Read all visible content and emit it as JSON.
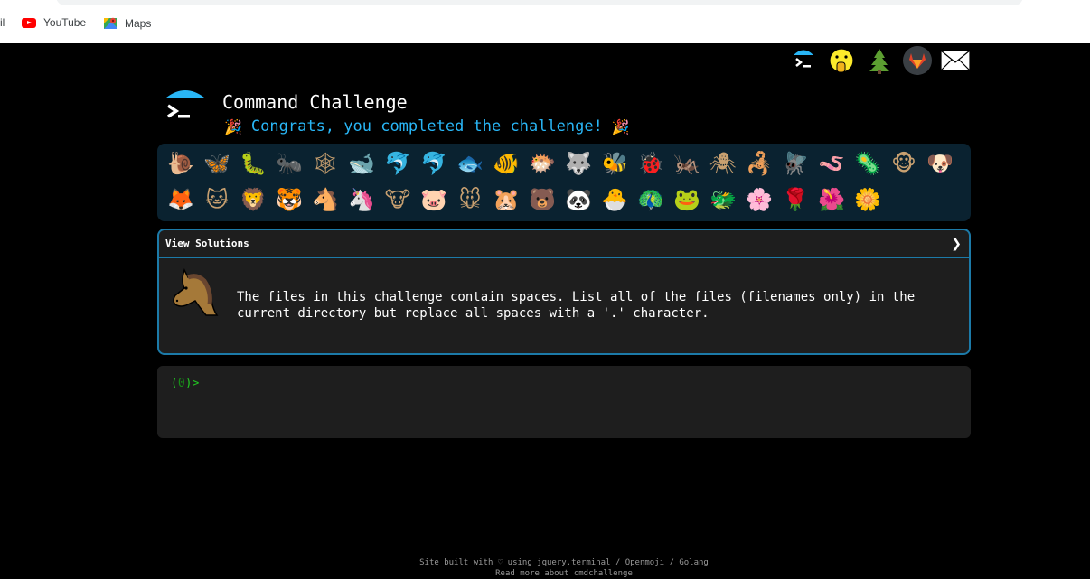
{
  "browser": {
    "bookmarks": [
      {
        "label": "il"
      },
      {
        "label": "YouTube"
      },
      {
        "label": "Maps"
      }
    ]
  },
  "header": {
    "title": "Command Challenge",
    "congrats": "Congrats, you completed the challenge!",
    "party_emoji": "🎉"
  },
  "top_icons": [
    "terminal-logo-icon",
    "hush-face-icon",
    "tree-icon",
    "gitlab-icon",
    "envelope-icon"
  ],
  "emoji_rows": [
    [
      "🐌",
      "🦋",
      "🐛",
      "🐜",
      "🕸",
      "🐋",
      "🐬",
      "🐬",
      "🐟",
      "🐠",
      "🐡",
      "🐺",
      "🐝",
      "🐞",
      "🦗",
      "🕷",
      "🦂",
      "🪰",
      "🪱",
      "🦠",
      "🐵",
      "🐶"
    ],
    [
      "🦊",
      "🐱",
      "🦁",
      "🐯",
      "🐴",
      "🦄",
      "🐮",
      "🐷",
      "🐭",
      "🐹",
      "🐻",
      "🐼",
      "🐣",
      "🦚",
      "🐸",
      "🐲",
      "🌸",
      "🌹",
      "🌺",
      "🌼"
    ]
  ],
  "challenge": {
    "panel_label": "View Solutions",
    "chevron": "❯",
    "line1": "The files in this challenge contain spaces. List all of the files (filenames only) in the",
    "line2": "current directory but replace all spaces with a '.' character."
  },
  "terminal": {
    "prompt_open": "(",
    "prompt_count": "0",
    "prompt_close": ")>"
  },
  "footer": {
    "line1_prefix": "Site built with ♡ using ",
    "link_terminal": "jquery.terminal",
    "sep1": " / ",
    "link_openmoji": "Openmoji",
    "sep2": " / ",
    "link_golang": "Golang",
    "line2": "Read more about cmdchallenge"
  },
  "colors": {
    "accent": "#29b6f6",
    "panel_border": "#1c7aa8",
    "prompt_green": "#22c422",
    "background": "#000000"
  }
}
